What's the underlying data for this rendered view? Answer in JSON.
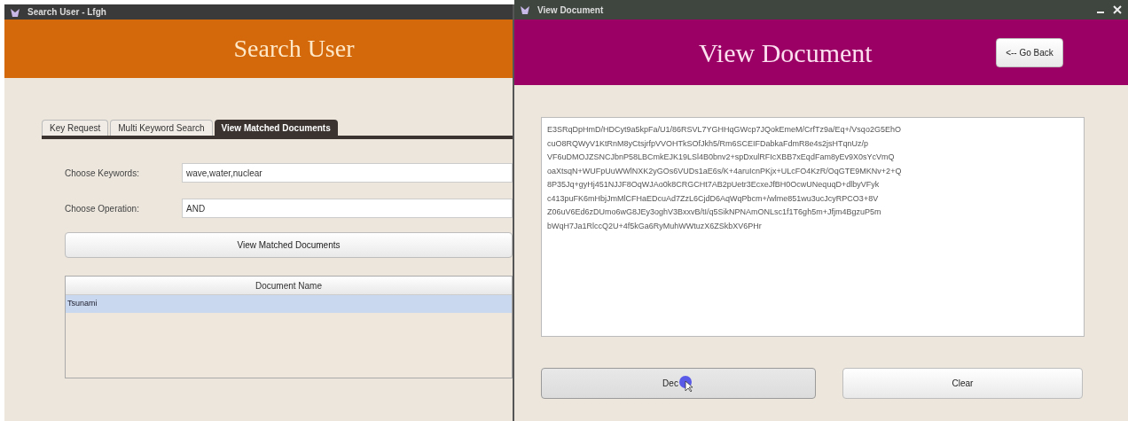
{
  "search_window": {
    "title": "Search User - Lfgh",
    "header": "Search User",
    "tabs": [
      {
        "label": "Key Request",
        "selected": false
      },
      {
        "label": "Multi Keyword Search",
        "selected": false
      },
      {
        "label": "View Matched Documents",
        "selected": true
      }
    ],
    "fields": [
      {
        "label": "Choose Keywords:",
        "value": "wave,water,nuclear"
      },
      {
        "label": "Choose Operation:",
        "value": "AND"
      }
    ],
    "action_button": "View Matched Documents",
    "table": {
      "columns": [
        "Document Name"
      ],
      "rows": [
        {
          "cells": [
            "Tsunami"
          ],
          "selected": true
        }
      ]
    }
  },
  "document_window": {
    "title": "View Document",
    "header": "View Document",
    "back_button": "<-- Go Back",
    "content": "E3SRqDpHmD/HDCyt9a5kpFa/U1/86RSVL7YGHHqGWcp7JQokEmeM/CrfTz9a/Eq+/Vsqo2G5EhO\ncuO8RQWyV1KtRnM8yCtsjrfpVVOHTkSOfJkh5/Rm6SCEIFDabkaFdmR8e4s2jsHTqnUz/p\nVF6uDMOJZSNCJbnP58LBCmkEJK19LSl4B0bnv2+spDxulRFIcXBB7xEqdFam8yEv9X0sYcVmQ\noaXtsqN+WUFpUuWWlNXK2yGOs6VUDs1aE6s/K+4aruIcnPKjx+ULcFO4KzR/OqGTE9MKNv+2+Q\n8P35Jq+gyHj451NJJF8OqWJAo0k8CRGCHt7AB2pUetr3EcxeJfBH0OcwUNequqD+dlbyVFyk\nc413puFK6mHbjJmMlCFHaEDcuAd7ZzL6CjdD6AqWqPbcm+/wlme851wu3ucJcyRPCO3+8V\nZ06uV6Ed6zDUmo6wG8JEy3oghV3BxxvB/tI/q5SikNPNAmONLsc1f1T6gh5m+Jfjm4BgzuP5m\nbWqH7Ja1RlccQ2U+4f5kGa6RyMuhWWtuzX6ZSkbXV6PHr",
    "buttons": [
      {
        "label": "Dec",
        "kind": "decrypt",
        "pressed": true
      },
      {
        "label": "Clear",
        "kind": "clear",
        "pressed": false
      }
    ]
  }
}
